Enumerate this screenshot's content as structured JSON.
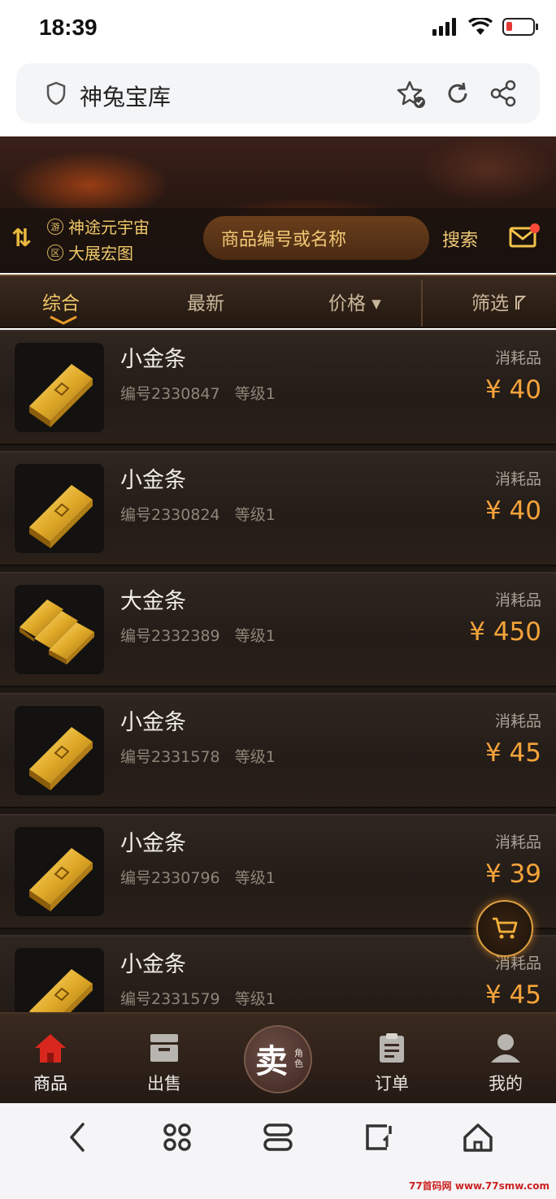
{
  "status_bar": {
    "time": "18:39"
  },
  "browser": {
    "page_title": "神兔宝库"
  },
  "header": {
    "server_line1_tag": "游",
    "server_line1": "神途元宇宙",
    "server_line2_tag": "区",
    "server_line2": "大展宏图",
    "search_placeholder": "商品编号或名称",
    "search_button": "搜索"
  },
  "filters": {
    "tabs": [
      {
        "label": "综合",
        "active": true
      },
      {
        "label": "最新",
        "active": false
      },
      {
        "label": "价格 ▾",
        "active": false
      }
    ],
    "filter_label": "筛选"
  },
  "items": [
    {
      "name": "小金条",
      "id_label": "编号2330847",
      "level_label": "等级1",
      "type": "消耗品",
      "price": "¥ 40",
      "icon": "gold-bar-icon"
    },
    {
      "name": "小金条",
      "id_label": "编号2330824",
      "level_label": "等级1",
      "type": "消耗品",
      "price": "¥ 40",
      "icon": "gold-bar-icon"
    },
    {
      "name": "大金条",
      "id_label": "编号2332389",
      "level_label": "等级1",
      "type": "消耗品",
      "price": "¥ 450",
      "icon": "gold-bars-stack-icon"
    },
    {
      "name": "小金条",
      "id_label": "编号2331578",
      "level_label": "等级1",
      "type": "消耗品",
      "price": "¥ 45",
      "icon": "gold-bar-icon"
    },
    {
      "name": "小金条",
      "id_label": "编号2330796",
      "level_label": "等级1",
      "type": "消耗品",
      "price": "¥ 39",
      "icon": "gold-bar-icon"
    },
    {
      "name": "小金条",
      "id_label": "编号2331579",
      "level_label": "等级1",
      "type": "消耗品",
      "price": "¥ 45",
      "icon": "gold-bar-icon"
    }
  ],
  "bottom_nav": {
    "goods": "商品",
    "sell_list": "出售",
    "sell_main": "卖",
    "sell_sub": "角色",
    "orders": "订单",
    "mine": "我的"
  },
  "watermark": "77首码网 www.77smw.com",
  "colors": {
    "accent_gold": "#f2c96a",
    "price_orange": "#f5a33a",
    "nav_active_red": "#d8281e"
  }
}
